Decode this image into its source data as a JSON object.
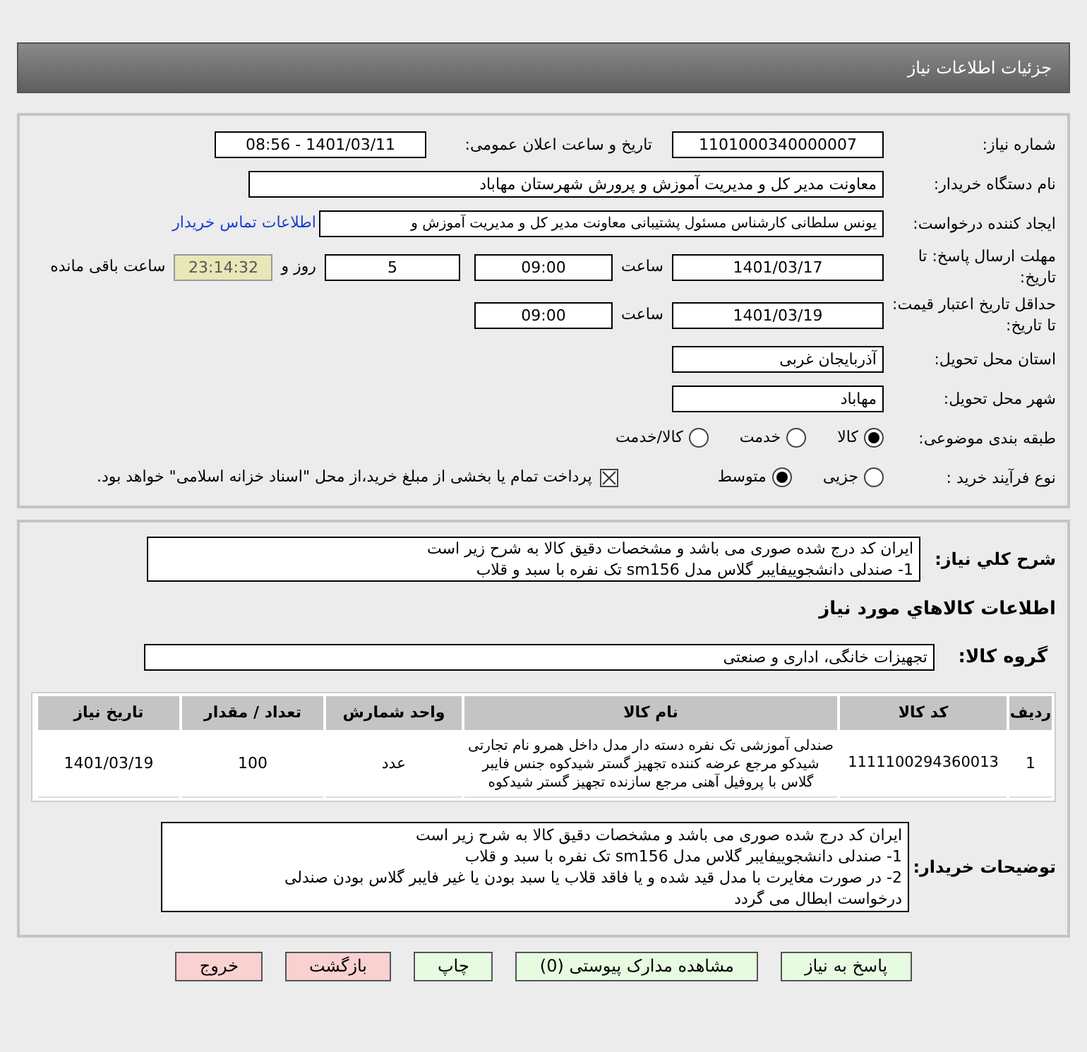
{
  "header": {
    "title": "جزئیات اطلاعات نیاز"
  },
  "need_number": {
    "label": "شماره نیاز:",
    "value": "1101000340000007"
  },
  "announce": {
    "label": "تاریخ و ساعت اعلان عمومی:",
    "value": "1401/03/11 - 08:56"
  },
  "buyer_org": {
    "label": "نام دستگاه خریدار:",
    "value": "معاونت مدیر کل و مدیریت آموزش و پرورش شهرستان مهاباد"
  },
  "requester": {
    "label": "ایجاد کننده درخواست:",
    "value": "یونس سلطانی کارشناس مسئول پشتیبانی معاونت مدیر کل و مدیریت آموزش و",
    "link": "اطلاعات تماس خریدار"
  },
  "deadline": {
    "label": "مهلت ارسال پاسخ: تا تاریخ:",
    "date": "1401/03/17",
    "time_label": "ساعت",
    "time": "09:00",
    "days": "5",
    "days_label": "روز و",
    "remaining": "23:14:32",
    "remaining_label": "ساعت باقی مانده"
  },
  "validity": {
    "label": "حداقل تاریخ اعتبار قیمت: تا تاریخ:",
    "date": "1401/03/19",
    "time_label": "ساعت",
    "time": "09:00"
  },
  "province": {
    "label": "استان محل تحویل:",
    "value": "آذربایجان غربی"
  },
  "city": {
    "label": "شهر محل تحویل:",
    "value": "مهاباد"
  },
  "category": {
    "label": "طبقه بندی موضوعی:",
    "options": [
      {
        "label": "کالا",
        "selected": true
      },
      {
        "label": "خدمت",
        "selected": false
      },
      {
        "label": "کالا/خدمت",
        "selected": false
      }
    ]
  },
  "process": {
    "label": "نوع فرآیند خرید :",
    "options": [
      {
        "label": "جزیی",
        "selected": false
      },
      {
        "label": "متوسط",
        "selected": true
      }
    ],
    "payment": {
      "checked": true,
      "text": "پرداخت تمام یا بخشی از مبلغ خرید،از محل \"اسناد خزانه اسلامی\" خواهد بود."
    }
  },
  "description": {
    "label": "شرح کلي نياز:",
    "lines": [
      "ایران کد درج شده صوری می باشد و مشخصات دقیق کالا به شرح زیر است",
      "1- صندلی دانشجوییفایبر گلاس مدل sm156 تک نفره با سبد و قلاب"
    ]
  },
  "goods_heading": "اطلاعات کالاهاي مورد نياز",
  "goods_group": {
    "label": "گروه کالا:",
    "value": "تجهیزات خانگی، اداری و صنعتی"
  },
  "table": {
    "columns": [
      "ردیف",
      "کد کالا",
      "نام کالا",
      "واحد شمارش",
      "تعداد / مقدار",
      "تاریخ نیاز"
    ],
    "rows": [
      [
        "1",
        "1111100294360013",
        "صندلی آموزشی تک نفره دسته دار مدل داخل همرو نام تجارتی شیدکو مرجع عرضه کننده تجهیز گستر شیدکوه جنس فایبر گلاس با پروفیل آهنی مرجع سازنده تجهیز گستر شیدکوه",
        "عدد",
        "100",
        "1401/03/19"
      ]
    ]
  },
  "buyer_notes": {
    "label": "توضیحات خریدار:",
    "lines": [
      "ایران کد درج شده صوری می باشد و مشخصات دقیق کالا به شرح زیر است",
      "1- صندلی دانشجوییفایبر گلاس مدل sm156 تک نفره با سبد و قلاب",
      "2- در صورت مغایرت با مدل قید شده و یا فاقد قلاب یا سبد بودن یا غیر فایبر گلاس بودن صندلی",
      "درخواست ابطال می گردد"
    ]
  },
  "buttons": [
    {
      "label": "پاسخ به نیاز",
      "kind": "normal"
    },
    {
      "label": "مشاهده مدارک پیوستی (0)",
      "kind": "normal"
    },
    {
      "label": "چاپ",
      "kind": "normal"
    },
    {
      "label": "بازگشت",
      "kind": "danger"
    },
    {
      "label": "خروج",
      "kind": "danger"
    }
  ]
}
